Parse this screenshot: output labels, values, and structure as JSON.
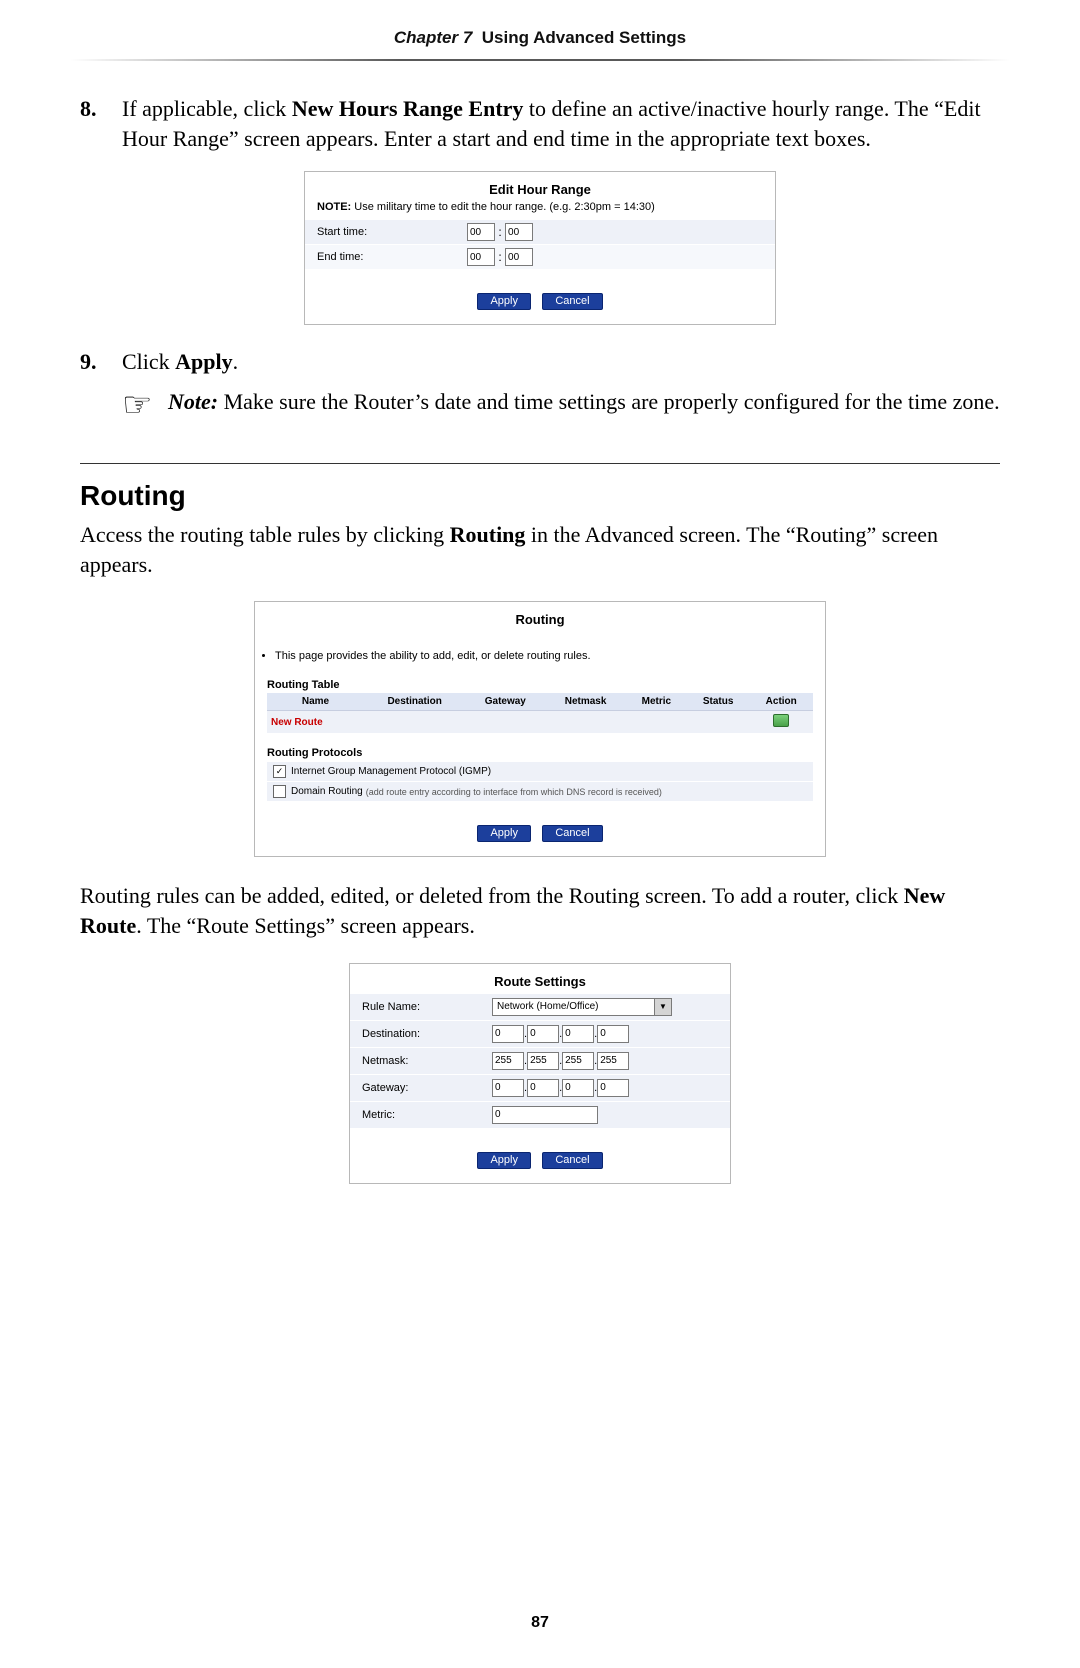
{
  "header": {
    "chapter_prefix": "Chapter 7",
    "chapter_title": "Using Advanced Settings"
  },
  "steps": {
    "s8": {
      "num": "8.",
      "text_pre": "If applicable, click ",
      "bold1": "New Hours Range Entry",
      "text_post": " to define an active/inactive hourly range. The “Edit Hour Range” screen appears. Enter a start and end time in the appropriate text boxes."
    },
    "s9": {
      "num": "9.",
      "text_pre": "Click ",
      "bold1": "Apply",
      "text_post": "."
    }
  },
  "note": {
    "label": "Note:",
    "text": " Make sure the Router’s date and time settings are properly configured for the time zone."
  },
  "ehr": {
    "title": "Edit Hour Range",
    "note_label": "NOTE:",
    "note_text": " Use military time to edit the hour range. (e.g. 2:30pm = 14:30)",
    "start_label": "Start time:",
    "end_label": "End time:",
    "start_hh": "00",
    "start_mm": "00",
    "end_hh": "00",
    "end_mm": "00",
    "apply": "Apply",
    "cancel": "Cancel"
  },
  "routing_section": {
    "heading": "Routing",
    "para_pre": "Access the routing table rules by clicking ",
    "para_bold": "Routing",
    "para_post": " in the Advanced screen. The “Routing” screen appears."
  },
  "routing_dlg": {
    "title": "Routing",
    "desc": "This page provides the ability to add, edit, or delete routing rules.",
    "table_heading": "Routing Table",
    "cols": {
      "name": "Name",
      "dest": "Destination",
      "gw": "Gateway",
      "mask": "Netmask",
      "metric": "Metric",
      "status": "Status",
      "action": "Action"
    },
    "new_route": "New Route",
    "protocols_heading": "Routing Protocols",
    "igmp": "Internet Group Management Protocol (IGMP)",
    "domain_routing": "Domain Routing",
    "domain_routing_fine": "(add route entry according to interface from which DNS record is received)",
    "apply": "Apply",
    "cancel": "Cancel"
  },
  "routing_para2": {
    "pre": "Routing rules can be added, edited, or deleted from the Routing screen. To add a router, click ",
    "bold": "New Route",
    "post": ". The “Route Settings” screen appears."
  },
  "route_settings": {
    "title": "Route Settings",
    "rule_name_label": "Rule Name:",
    "rule_name_value": "Network (Home/Office)",
    "dest_label": "Destination:",
    "dest": [
      "0",
      "0",
      "0",
      "0"
    ],
    "mask_label": "Netmask:",
    "mask": [
      "255",
      "255",
      "255",
      "255"
    ],
    "gw_label": "Gateway:",
    "gw": [
      "0",
      "0",
      "0",
      "0"
    ],
    "metric_label": "Metric:",
    "metric": "0",
    "apply": "Apply",
    "cancel": "Cancel"
  },
  "page_number": "87"
}
